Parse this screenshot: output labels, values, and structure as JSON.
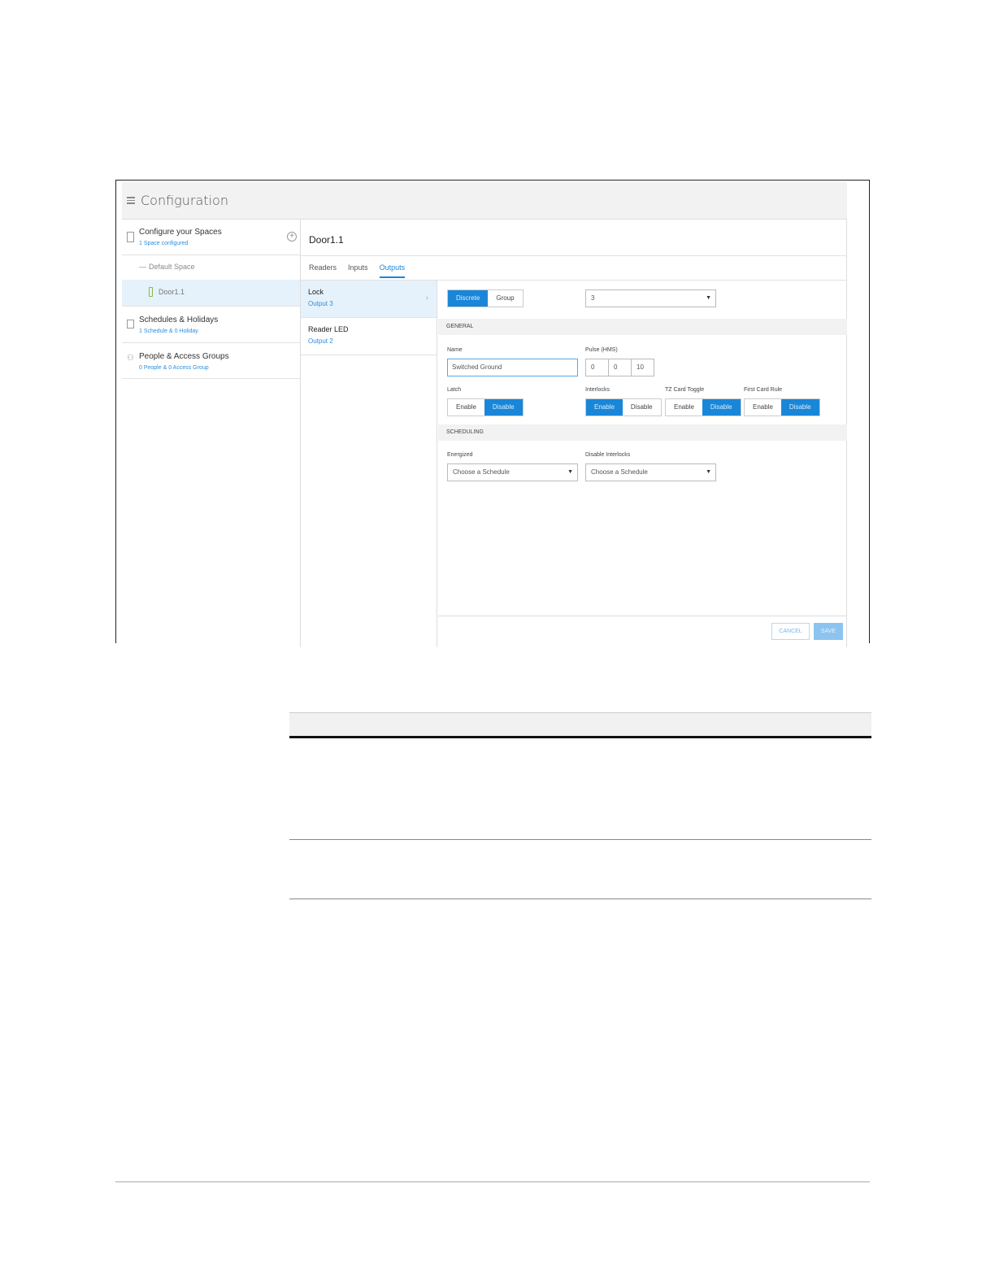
{
  "app": {
    "title": "Configuration"
  },
  "sidebar": {
    "spaces": {
      "title": "Configure your Spaces",
      "subtitle": "1 Space configured"
    },
    "default_space": "Default Space",
    "door": "Door1.1",
    "schedules": {
      "title": "Schedules & Holidays",
      "subtitle": "1 Schedule & 0 Holiday"
    },
    "people": {
      "title": "People & Access Groups",
      "subtitle": "0 People & 0 Access Group"
    }
  },
  "content": {
    "door_title": "Door1.1",
    "tabs": [
      {
        "label": "Readers",
        "active": false
      },
      {
        "label": "Inputs",
        "active": false
      },
      {
        "label": "Outputs",
        "active": true
      }
    ],
    "outputs": [
      {
        "name": "Lock",
        "sub": "Output 3",
        "active": true
      },
      {
        "name": "Reader LED",
        "sub": "Output 2",
        "active": false
      }
    ]
  },
  "detail": {
    "mode": {
      "discrete": "Discrete",
      "group": "Group",
      "selected": "Discrete"
    },
    "output_number": "3",
    "general_label": "GENERAL",
    "name_label": "Name",
    "name_value": "Switched Ground",
    "pulse_label": "Pulse (HMS)",
    "pulse": [
      "0",
      "0",
      "10"
    ],
    "latch": {
      "label": "Latch",
      "enable": "Enable",
      "disable": "Disable",
      "selected": "Disable"
    },
    "interlocks": {
      "label": "Interlocks",
      "enable": "Enable",
      "disable": "Disable",
      "selected": "Enable"
    },
    "tz_card_toggle": {
      "label": "TZ Card Toggle",
      "enable": "Enable",
      "disable": "Disable",
      "selected": "Disable"
    },
    "first_card_rule": {
      "label": "First Card Rule",
      "enable": "Enable",
      "disable": "Disable",
      "selected": "Disable"
    },
    "scheduling_label": "SCHEDULING",
    "energized": {
      "label": "Energized",
      "placeholder": "Choose a Schedule"
    },
    "disable_interlocks": {
      "label": "Disable Interlocks",
      "placeholder": "Choose a Schedule"
    },
    "cancel": "CANCEL",
    "save": "SAVE"
  },
  "colors": {
    "accent": "#1a86d8",
    "link": "#2a8ee0",
    "selected_row": "#e6f2fb",
    "header_bg": "#f2f2f2"
  }
}
